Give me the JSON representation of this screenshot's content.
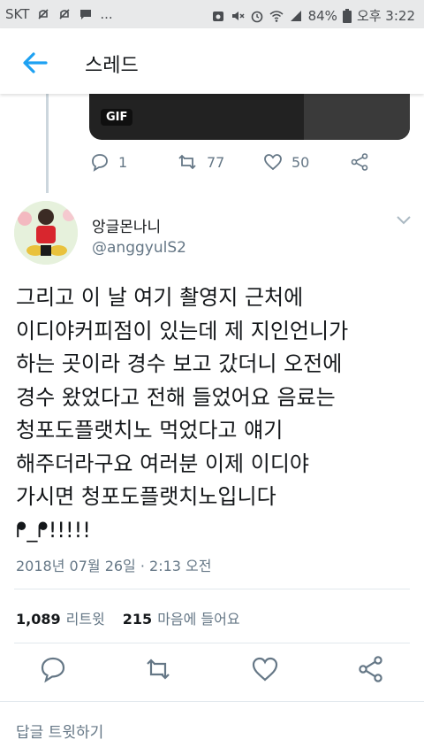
{
  "status_bar": {
    "carrier": "SKT",
    "notification_icons": [
      "muted-notification-icon",
      "muted-notification-icon",
      "message-icon"
    ],
    "more": "...",
    "battery_percent": "84%",
    "time": "오후 3:22"
  },
  "header": {
    "title": "스레드"
  },
  "previous_tweet": {
    "gif_label": "GIF",
    "reply_count": "1",
    "retweet_count": "77",
    "like_count": "50"
  },
  "tweet": {
    "display_name": "앙글몬나니",
    "handle": "@anggyulS2",
    "text": "그리고 이 날 여기 촬영지 근처에\n이디야커피점이 있는데 제 지인언니가\n하는 곳이라 경수 보고 갔더니 오전에\n경수 왔었다고 전해 들었어요 음료는\n청포도플랫치노 먹었다고 얘기\n해주더라구요 여러분 이제 이디야\n가시면 청포도플랫치노입니다\nᖰ_ᖰ!!!!!",
    "timestamp": "2018년 07월 26일 · 2:13 오전",
    "retweets": "1,089",
    "retweets_label": "리트윗",
    "likes": "215",
    "likes_label": "마음에 들어요"
  },
  "reply": {
    "placeholder": "답글 트윗하기"
  },
  "colors": {
    "accent": "#1da1f2",
    "muted": "#657786",
    "divider": "#e1e8ed"
  }
}
